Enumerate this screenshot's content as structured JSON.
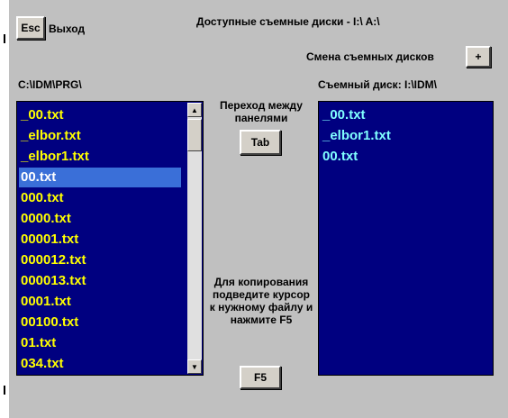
{
  "toolbar": {
    "esc_label": "Esc",
    "exit_label": "Выход",
    "available_disks": "Доступные съемные диски - I:\\ A:\\",
    "change_disks_label": "Смена съемных дисков",
    "change_disks_button": "+"
  },
  "left_panel": {
    "path": "C:\\IDM\\PRG\\",
    "files": [
      "_00.txt",
      "_elbor.txt",
      "_elbor1.txt",
      "00.txt",
      "000.txt",
      "0000.txt",
      "00001.txt",
      "000012.txt",
      "000013.txt",
      "0001.txt",
      "00100.txt",
      "01.txt",
      "034.txt"
    ],
    "selected_index": 3
  },
  "right_panel": {
    "path": "Съемный диск: I:\\IDM\\",
    "files": [
      "_00.txt",
      "_elbor1.txt",
      "00.txt"
    ]
  },
  "middle": {
    "switch_label": "Переход между панелями",
    "tab_button": "Tab",
    "copy_label": "Для копирования подведите курсор к нужному файлу и нажмите F5",
    "f5_button": "F5"
  },
  "colors": {
    "panel_bg": "#000080",
    "left_text": "#ffff00",
    "right_text": "#80ffff",
    "selection": "#3a6fd8",
    "window_bg": "#c0c0c0"
  }
}
